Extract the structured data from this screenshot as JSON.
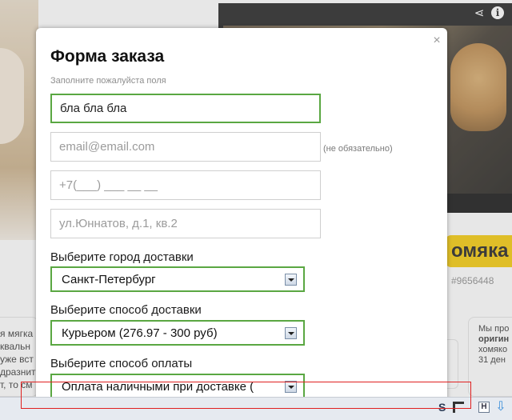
{
  "modal": {
    "title": "Форма заказа",
    "hint": "Заполните пожалуйста поля",
    "close_glyph": "×",
    "fields": {
      "name_value": "бла бла бла",
      "email_placeholder": "email@email.com",
      "email_note": "(не обязательно)",
      "phone_placeholder": "+7(___) ___ __ __",
      "address_placeholder": "ул.Юннатов, д.1, кв.2"
    },
    "city": {
      "label": "Выберите город доставки",
      "value": "Санкт-Петербург"
    },
    "delivery": {
      "label": "Выберите способ доставки",
      "value": "Курьером (276.97 - 300 руб)"
    },
    "payment": {
      "label": "Выберите способ оплаты",
      "value": "Оплата наличными при доставке ("
    }
  },
  "background": {
    "buy_button_text": "омяка",
    "sku": "#9656448",
    "left_card_lines": [
      "я мягка",
      "квальн",
      "уже вст",
      "дразнит",
      "т, то см"
    ],
    "right_card_lines": [
      "Мы про",
      "оригин",
      "хомяко",
      "31 ден"
    ],
    "video_share_glyph": "⋖",
    "video_info_glyph": "i"
  },
  "statusbar": {
    "s_glyph": "S",
    "h_glyph": "H",
    "download_glyph": "⇩"
  },
  "colors": {
    "accent_green": "#5aa742",
    "buy_yellow": "#f5c800",
    "highlight_red": "#e02020"
  }
}
